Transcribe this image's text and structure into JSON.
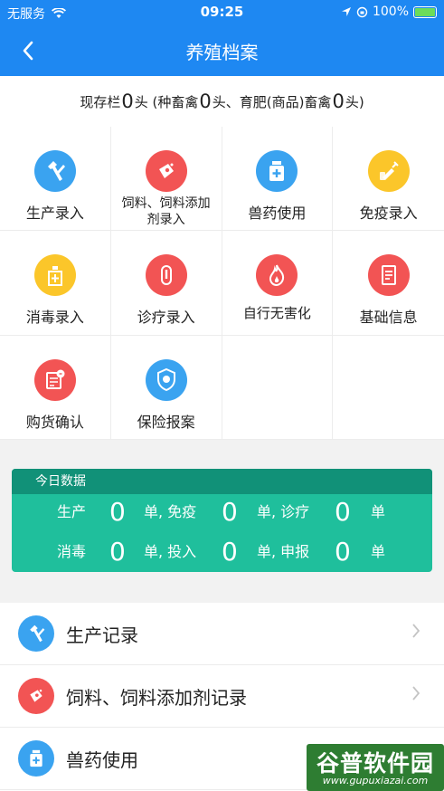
{
  "status_bar": {
    "carrier": "无服务",
    "time": "09:25",
    "battery": "100%"
  },
  "nav": {
    "title": "养殖档案"
  },
  "stock": {
    "pre": "现存栏 ",
    "total": "0",
    "mid1": "头 (种畜禽 ",
    "breed": "0",
    "mid2": "头、育肥(商品)畜禽 ",
    "fatten": "0",
    "end": "头)"
  },
  "grid": [
    {
      "label": "生产录入",
      "icon": "hammer-icon"
    },
    {
      "label": "饲料、饲料添加剂录入",
      "icon": "feed-bag-icon"
    },
    {
      "label": "兽药使用",
      "icon": "medicine-bottle-icon"
    },
    {
      "label": "免疫录入",
      "icon": "syringe-icon"
    },
    {
      "label": "消毒录入",
      "icon": "disinfect-spray-icon"
    },
    {
      "label": "诊疗录入",
      "icon": "thermometer-icon"
    },
    {
      "label": "自行无害化",
      "icon": "flame-icon"
    },
    {
      "label": "基础信息",
      "icon": "document-icon"
    },
    {
      "label": "购货确认",
      "icon": "purchase-receipt-icon"
    },
    {
      "label": "保险报案",
      "icon": "insurance-shield-icon"
    }
  ],
  "today": {
    "title": "今日数据",
    "row1": {
      "l1": "生产",
      "v1": "0",
      "l2": "单, 免疫",
      "v2": "0",
      "l3": "单, 诊疗",
      "v3": "0",
      "l4": "单"
    },
    "row2": {
      "l1": "消毒",
      "v1": "0",
      "l2": "单, 投入",
      "v2": "0",
      "l3": "单, 申报",
      "v3": "0",
      "l4": "单"
    }
  },
  "records": [
    {
      "label": "生产记录",
      "icon": "hammer-icon"
    },
    {
      "label": "饲料、饲料添加剂记录",
      "icon": "feed-bag-icon"
    },
    {
      "label": "兽药使用",
      "icon": "medicine-bottle-icon"
    }
  ],
  "watermark": {
    "line1": "谷普软件园",
    "line2": "www.gupuxiazai.com"
  },
  "colors": {
    "primary": "#1e88f2",
    "teal": "#1fbf9c",
    "teal_dark": "#119178",
    "red": "#f25454",
    "yellow": "#fbc62a",
    "blue": "#3aa3f0"
  }
}
